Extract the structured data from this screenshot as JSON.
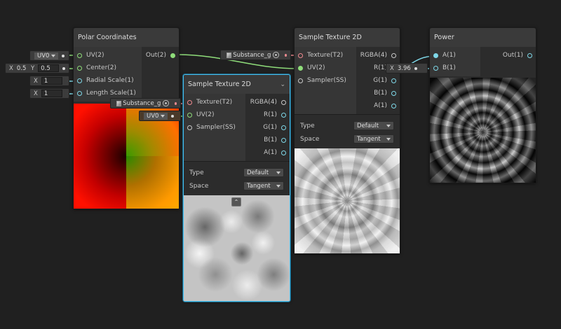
{
  "nodes": {
    "polar": {
      "title": "Polar Coordinates",
      "inputs": [
        "UV(2)",
        "Center(2)",
        "Radial Scale(1)",
        "Length Scale(1)"
      ],
      "outputs": [
        "Out(2)"
      ]
    },
    "sample_left": {
      "title": "Sample Texture 2D",
      "inputs": [
        "Texture(T2)",
        "UV(2)",
        "Sampler(SS)"
      ],
      "outputs": [
        "RGBA(4)",
        "R(1)",
        "G(1)",
        "B(1)",
        "A(1)"
      ],
      "type_label": "Type",
      "type_value": "Default",
      "space_label": "Space",
      "space_value": "Tangent"
    },
    "sample_right": {
      "title": "Sample Texture 2D",
      "inputs": [
        "Texture(T2)",
        "UV(2)",
        "Sampler(SS)"
      ],
      "outputs": [
        "RGBA(4)",
        "R(1)",
        "G(1)",
        "B(1)",
        "A(1)"
      ],
      "type_label": "Type",
      "type_value": "Default",
      "space_label": "Space",
      "space_value": "Tangent"
    },
    "power": {
      "title": "Power",
      "inputs": [
        "A(1)",
        "B(1)"
      ],
      "outputs": [
        "Out(1)"
      ]
    }
  },
  "fields": {
    "polar_uv": "UV0",
    "polar_center_x_label": "X",
    "polar_center_x": "0.5",
    "polar_center_y_label": "Y",
    "polar_center_y": "0.5",
    "polar_radial_label": "X",
    "polar_radial": "1",
    "polar_length_label": "X",
    "polar_length": "1",
    "left_texture": "Substance_g",
    "left_uv": "UV0",
    "right_texture": "Substance_g",
    "power_b_label": "X",
    "power_b": "3.96"
  },
  "colors": {
    "background": "#202020",
    "wire_green": "#8fdd7a",
    "wire_cyan": "#7fd8e8",
    "wire_pink": "#f08a90",
    "selection": "#44c0f0"
  }
}
